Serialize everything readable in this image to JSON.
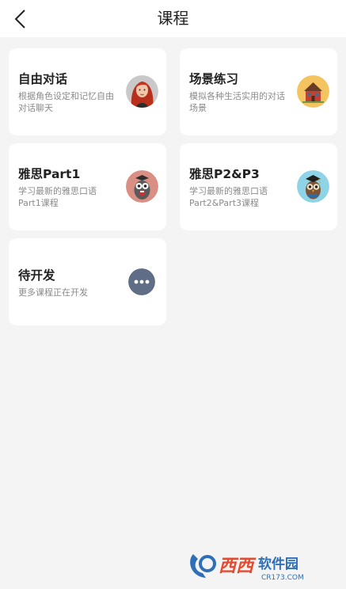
{
  "header": {
    "title": "课程"
  },
  "cards": [
    {
      "title": "自由对话",
      "desc": "根据角色设定和记忆自由对话聊天",
      "icon": "woman-avatar-icon"
    },
    {
      "title": "场景练习",
      "desc": "模拟各种生活实用的对话场景",
      "icon": "house-icon"
    },
    {
      "title": "雅思Part1",
      "desc": "学习最新的雅思口语Part1课程",
      "icon": "owl-mascot-icon"
    },
    {
      "title": "雅思P2&P3",
      "desc": "学习最新的雅思口语Part2&Part3课程",
      "icon": "owl-graduate-icon"
    },
    {
      "title": "待开发",
      "desc": "更多课程正在开发",
      "icon": "more-dots-icon"
    }
  ],
  "watermark": {
    "brand": "西西",
    "suffix": "软件园",
    "url": "CR173.COM"
  }
}
